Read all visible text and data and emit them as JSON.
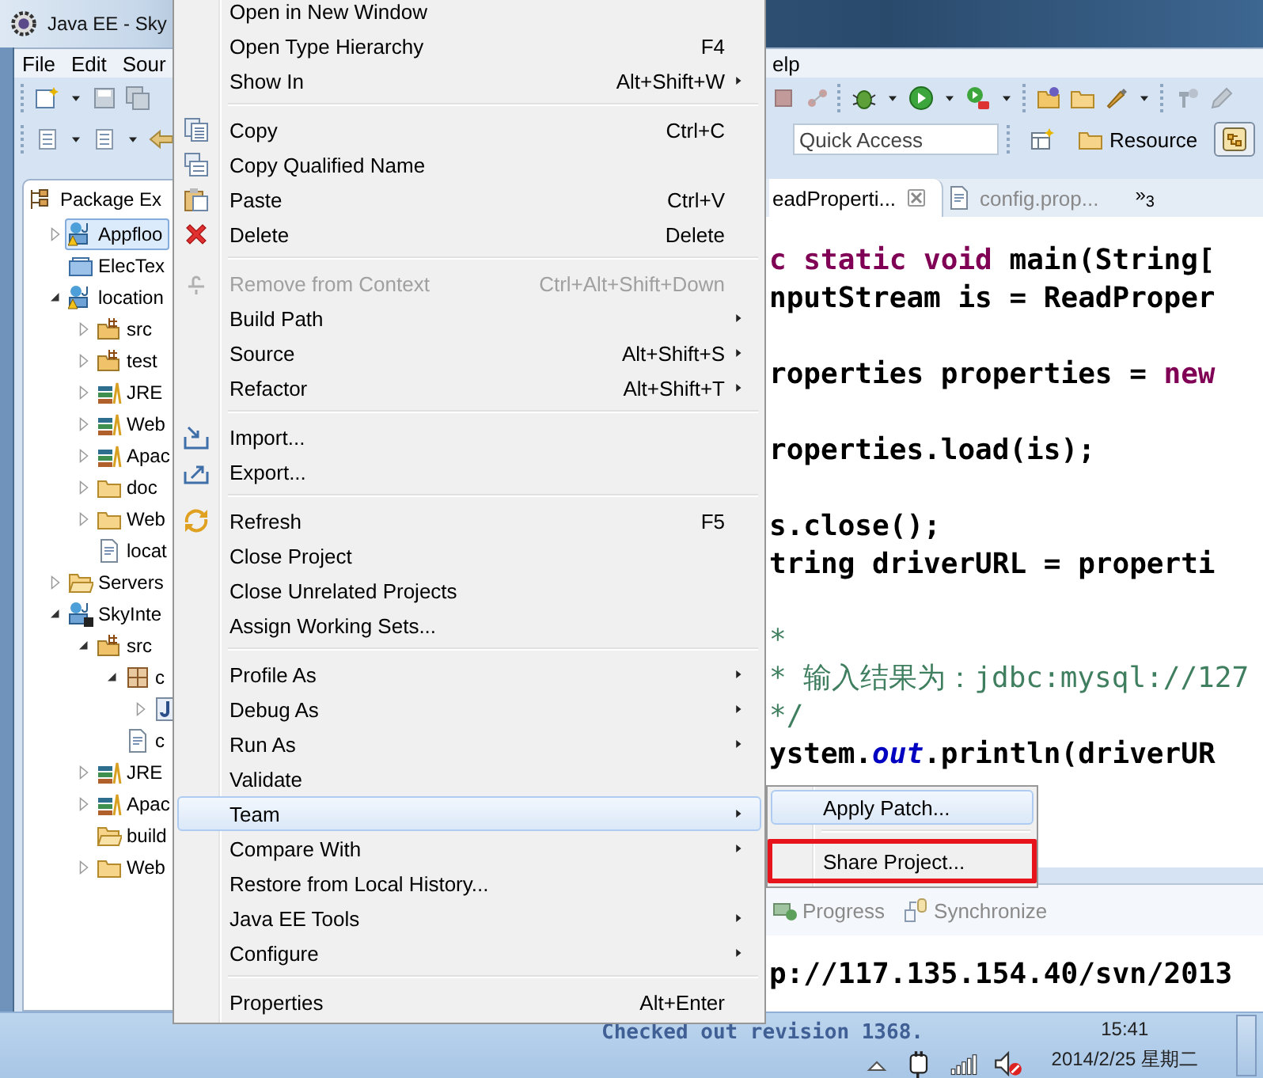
{
  "window": {
    "title": "Java EE - Sky"
  },
  "menu_bar": {
    "left": [
      "File",
      "Edit",
      "Sour"
    ],
    "right": [
      "elp"
    ]
  },
  "quick_access": {
    "placeholder": "Quick Access"
  },
  "perspectives": [
    {
      "kind": "open",
      "selected": false
    },
    {
      "kind": "named",
      "label": "Resource",
      "selected": false
    },
    {
      "kind": "icon",
      "selected": true
    }
  ],
  "package_explorer": {
    "title": "Package Ex",
    "tree": [
      {
        "label": "Appfloo",
        "kind": "project-warning",
        "expanded": false,
        "selected": true
      },
      {
        "label": "ElecTex",
        "kind": "closed-project",
        "selected": false
      },
      {
        "label": "location",
        "kind": "project-warning",
        "expanded": true,
        "selected": false,
        "children": [
          {
            "label": "src",
            "kind": "source-folder",
            "expanded": false,
            "selected": false
          },
          {
            "label": "test",
            "kind": "source-folder",
            "expanded": false,
            "selected": false
          },
          {
            "label": "JRE",
            "kind": "library",
            "expanded": false,
            "selected": false
          },
          {
            "label": "Web",
            "kind": "library",
            "expanded": false,
            "selected": false
          },
          {
            "label": "Apac",
            "kind": "library",
            "expanded": false,
            "selected": false
          },
          {
            "label": "doc",
            "kind": "folder",
            "expanded": false,
            "selected": false
          },
          {
            "label": "Web",
            "kind": "folder",
            "expanded": false,
            "selected": false
          },
          {
            "label": "locat",
            "kind": "file",
            "selected": false
          }
        ]
      },
      {
        "label": "Servers",
        "kind": "open-folder",
        "expanded": false,
        "selected": false
      },
      {
        "label": "SkyInte",
        "kind": "project",
        "expanded": true,
        "selected": false,
        "children": [
          {
            "label": "src",
            "kind": "source-folder",
            "expanded": true,
            "selected": false,
            "children": [
              {
                "label": "c",
                "kind": "package",
                "expanded": true,
                "selected": false,
                "children": [
                  {
                    "kind": "java-file",
                    "expanded": false,
                    "selected": false
                  }
                ]
              },
              {
                "label": "c",
                "kind": "file",
                "selected": false
              }
            ]
          },
          {
            "label": "JRE",
            "kind": "library",
            "expanded": false,
            "selected": false
          },
          {
            "label": "Apac",
            "kind": "library",
            "expanded": false,
            "selected": false
          },
          {
            "label": "build",
            "kind": "open-folder",
            "selected": false
          },
          {
            "label": "Web",
            "kind": "folder",
            "expanded": false,
            "selected": false
          }
        ]
      }
    ]
  },
  "editor": {
    "tabs": [
      {
        "label": "eadProperti...",
        "selected": true,
        "closable": true
      },
      {
        "label": "config.prop...",
        "selected": false,
        "closable": false
      }
    ],
    "overflow": {
      "symbol": "»",
      "count": "3"
    },
    "lines": [
      {
        "kind": "code",
        "segments": [
          {
            "kind": "keyword",
            "text": "c static void"
          },
          {
            "kind": "text",
            "text": " main(String["
          }
        ]
      },
      {
        "kind": "code",
        "segments": [
          {
            "kind": "text",
            "text": "nputStream is = ReadProper"
          }
        ]
      },
      {
        "kind": "blank"
      },
      {
        "kind": "code",
        "segments": [
          {
            "kind": "text",
            "text": "roperties properties = "
          },
          {
            "kind": "keyword",
            "text": "new"
          }
        ]
      },
      {
        "kind": "blank"
      },
      {
        "kind": "code",
        "segments": [
          {
            "kind": "text",
            "text": "roperties.load(is);"
          }
        ]
      },
      {
        "kind": "blank"
      },
      {
        "kind": "code",
        "segments": [
          {
            "kind": "text",
            "text": "s.close();"
          }
        ]
      },
      {
        "kind": "code",
        "segments": [
          {
            "kind": "text",
            "text": "tring driverURL = properti"
          }
        ]
      },
      {
        "kind": "blank"
      },
      {
        "kind": "code",
        "segments": [
          {
            "kind": "comment",
            "text": "*"
          }
        ]
      },
      {
        "kind": "code",
        "segments": [
          {
            "kind": "comment",
            "text": "* 输入结果为：jdbc:mysql://127"
          }
        ]
      },
      {
        "kind": "code",
        "segments": [
          {
            "kind": "comment",
            "text": "*/"
          }
        ]
      },
      {
        "kind": "code",
        "segments": [
          {
            "kind": "text",
            "text": "ystem."
          },
          {
            "kind": "field",
            "text": "out"
          },
          {
            "kind": "text",
            "text": ".println(driverUR"
          }
        ]
      }
    ]
  },
  "bottom_panel": {
    "tabs": [
      "Progress",
      "Synchronize"
    ],
    "console": [
      "p://117.135.154.40/svn/2013",
      "Checked out revision 1368."
    ]
  },
  "context_menu": {
    "items": [
      {
        "kind": "item",
        "label": "Open in New Window",
        "disabled": false,
        "selected": false,
        "submenu": false
      },
      {
        "kind": "item",
        "label": "Open Type Hierarchy",
        "shortcut": "F4",
        "disabled": false,
        "selected": false,
        "submenu": false
      },
      {
        "kind": "item",
        "label": "Show In",
        "shortcut": "Alt+Shift+W",
        "disabled": false,
        "selected": false,
        "submenu": true
      },
      {
        "kind": "separator"
      },
      {
        "kind": "item",
        "label": "Copy",
        "shortcut": "Ctrl+C",
        "disabled": false,
        "selected": false,
        "submenu": false
      },
      {
        "kind": "item",
        "label": "Copy Qualified Name",
        "disabled": false,
        "selected": false,
        "submenu": false
      },
      {
        "kind": "item",
        "label": "Paste",
        "shortcut": "Ctrl+V",
        "disabled": false,
        "selected": false,
        "submenu": false
      },
      {
        "kind": "item",
        "label": "Delete",
        "shortcut": "Delete",
        "disabled": false,
        "selected": false,
        "submenu": false
      },
      {
        "kind": "separator"
      },
      {
        "kind": "item",
        "label": "Remove from Context",
        "shortcut": "Ctrl+Alt+Shift+Down",
        "disabled": true,
        "selected": false,
        "submenu": false
      },
      {
        "kind": "item",
        "label": "Build Path",
        "disabled": false,
        "selected": false,
        "submenu": true
      },
      {
        "kind": "item",
        "label": "Source",
        "shortcut": "Alt+Shift+S",
        "disabled": false,
        "selected": false,
        "submenu": true
      },
      {
        "kind": "item",
        "label": "Refactor",
        "shortcut": "Alt+Shift+T",
        "disabled": false,
        "selected": false,
        "submenu": true
      },
      {
        "kind": "separator"
      },
      {
        "kind": "item",
        "label": "Import...",
        "disabled": false,
        "selected": false,
        "submenu": false
      },
      {
        "kind": "item",
        "label": "Export...",
        "disabled": false,
        "selected": false,
        "submenu": false
      },
      {
        "kind": "separator"
      },
      {
        "kind": "item",
        "label": "Refresh",
        "shortcut": "F5",
        "disabled": false,
        "selected": false,
        "submenu": false
      },
      {
        "kind": "item",
        "label": "Close Project",
        "disabled": false,
        "selected": false,
        "submenu": false
      },
      {
        "kind": "item",
        "label": "Close Unrelated Projects",
        "disabled": false,
        "selected": false,
        "submenu": false
      },
      {
        "kind": "item",
        "label": "Assign Working Sets...",
        "disabled": false,
        "selected": false,
        "submenu": false
      },
      {
        "kind": "separator"
      },
      {
        "kind": "item",
        "label": "Profile As",
        "disabled": false,
        "selected": false,
        "submenu": true
      },
      {
        "kind": "item",
        "label": "Debug As",
        "disabled": false,
        "selected": false,
        "submenu": true
      },
      {
        "kind": "item",
        "label": "Run As",
        "disabled": false,
        "selected": false,
        "submenu": true
      },
      {
        "kind": "item",
        "label": "Validate",
        "disabled": false,
        "selected": false,
        "submenu": false
      },
      {
        "kind": "item",
        "label": "Team",
        "disabled": false,
        "selected": true,
        "submenu": true
      },
      {
        "kind": "item",
        "label": "Compare With",
        "disabled": false,
        "selected": false,
        "submenu": true
      },
      {
        "kind": "item",
        "label": "Restore from Local History...",
        "disabled": false,
        "selected": false,
        "submenu": false
      },
      {
        "kind": "item",
        "label": "Java EE Tools",
        "disabled": false,
        "selected": false,
        "submenu": true
      },
      {
        "kind": "item",
        "label": "Configure",
        "disabled": false,
        "selected": false,
        "submenu": true
      },
      {
        "kind": "separator"
      },
      {
        "kind": "item",
        "label": "Properties",
        "shortcut": "Alt+Enter",
        "disabled": false,
        "selected": false,
        "submenu": false
      }
    ]
  },
  "submenu": {
    "items": [
      {
        "kind": "item",
        "label": "Apply Patch...",
        "selected": true,
        "highlighted": false
      },
      {
        "kind": "separator"
      },
      {
        "kind": "item",
        "label": "Share Project...",
        "selected": false,
        "highlighted": true
      }
    ]
  },
  "taskbar": {
    "time": "15:41",
    "date": "2014/2/25 星期二"
  }
}
